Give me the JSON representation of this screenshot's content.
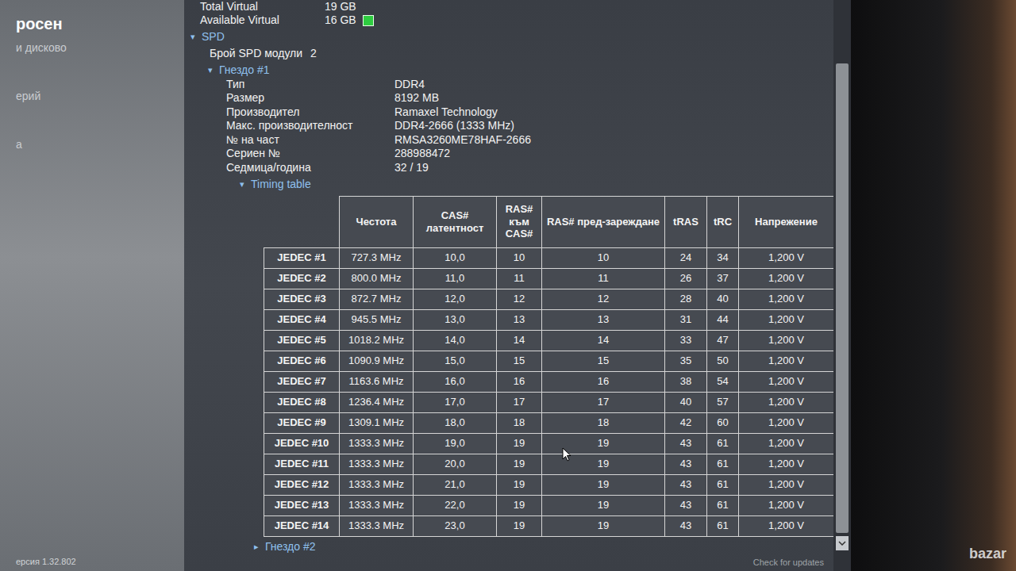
{
  "watermark": {
    "user": "росен",
    "logo": "bazar"
  },
  "sidebar": {
    "items": [
      "и дисково",
      "ерий",
      "а"
    ],
    "version": "ерсия 1.32.802"
  },
  "memory": [
    {
      "label": "Total Virtual",
      "value": "19 GB",
      "indicator": false
    },
    {
      "label": "Available Virtual",
      "value": "16 GB",
      "indicator": true
    }
  ],
  "tree": {
    "spd": {
      "arrow": "▾",
      "label": "SPD",
      "expanded": true
    },
    "module_count": {
      "label": "Брой SPD модули",
      "value": "2"
    },
    "slots": [
      {
        "arrow": "▾",
        "label": "Гнездо #1",
        "expanded": true,
        "properties": [
          {
            "label": "Тип",
            "value": "DDR4"
          },
          {
            "label": "Размер",
            "value": "8192 MB"
          },
          {
            "label": "Производител",
            "value": "Ramaxel Technology"
          },
          {
            "label": "Макс. производителност",
            "value": "DDR4-2666 (1333 MHz)"
          },
          {
            "label": "№ на част",
            "value": "RMSA3260ME78HAF-2666"
          },
          {
            "label": "Сериен №",
            "value": "288988472"
          },
          {
            "label": "Седмица/година",
            "value": "32 / 19"
          }
        ],
        "timing": {
          "arrow": "▾",
          "label": "Timing table",
          "expanded": true
        }
      },
      {
        "arrow": "▸",
        "label": "Гнездо #2",
        "expanded": false
      }
    ]
  },
  "table": {
    "columns": [
      "Честота",
      "CAS# латентност",
      "RAS# към CAS#",
      "RAS# пред-зареждане",
      "tRAS",
      "tRC",
      "Напрежение"
    ],
    "rows": [
      {
        "name": "JEDEC #1",
        "cells": [
          "727.3 MHz",
          "10,0",
          "10",
          "10",
          "24",
          "34",
          "1,200 V"
        ]
      },
      {
        "name": "JEDEC #2",
        "cells": [
          "800.0 MHz",
          "11,0",
          "11",
          "11",
          "26",
          "37",
          "1,200 V"
        ]
      },
      {
        "name": "JEDEC #3",
        "cells": [
          "872.7 MHz",
          "12,0",
          "12",
          "12",
          "28",
          "40",
          "1,200 V"
        ]
      },
      {
        "name": "JEDEC #4",
        "cells": [
          "945.5 MHz",
          "13,0",
          "13",
          "13",
          "31",
          "44",
          "1,200 V"
        ]
      },
      {
        "name": "JEDEC #5",
        "cells": [
          "1018.2 MHz",
          "14,0",
          "14",
          "14",
          "33",
          "47",
          "1,200 V"
        ]
      },
      {
        "name": "JEDEC #6",
        "cells": [
          "1090.9 MHz",
          "15,0",
          "15",
          "15",
          "35",
          "50",
          "1,200 V"
        ]
      },
      {
        "name": "JEDEC #7",
        "cells": [
          "1163.6 MHz",
          "16,0",
          "16",
          "16",
          "38",
          "54",
          "1,200 V"
        ]
      },
      {
        "name": "JEDEC #8",
        "cells": [
          "1236.4 MHz",
          "17,0",
          "17",
          "17",
          "40",
          "57",
          "1,200 V"
        ]
      },
      {
        "name": "JEDEC #9",
        "cells": [
          "1309.1 MHz",
          "18,0",
          "18",
          "18",
          "42",
          "60",
          "1,200 V"
        ]
      },
      {
        "name": "JEDEC #10",
        "cells": [
          "1333.3 MHz",
          "19,0",
          "19",
          "19",
          "43",
          "61",
          "1,200 V"
        ]
      },
      {
        "name": "JEDEC #11",
        "cells": [
          "1333.3 MHz",
          "20,0",
          "19",
          "19",
          "43",
          "61",
          "1,200 V"
        ]
      },
      {
        "name": "JEDEC #12",
        "cells": [
          "1333.3 MHz",
          "21,0",
          "19",
          "19",
          "43",
          "61",
          "1,200 V"
        ]
      },
      {
        "name": "JEDEC #13",
        "cells": [
          "1333.3 MHz",
          "22,0",
          "19",
          "19",
          "43",
          "61",
          "1,200 V"
        ]
      },
      {
        "name": "JEDEC #14",
        "cells": [
          "1333.3 MHz",
          "23,0",
          "19",
          "19",
          "43",
          "61",
          "1,200 V"
        ]
      }
    ]
  },
  "footer": {
    "link": "Check for updates"
  }
}
